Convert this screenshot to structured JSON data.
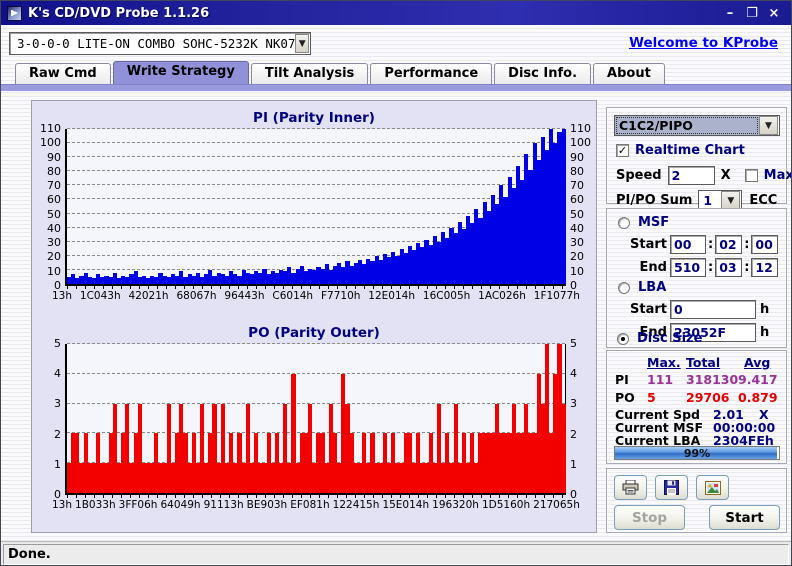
{
  "window": {
    "title": "K's CD/DVD Probe 1.1.26",
    "minimize": "–",
    "maximize": "❐",
    "close": "×",
    "status": "Done."
  },
  "toolbar": {
    "drive": "3-0-0-0 LITE-ON COMBO SOHC-5232K NK07",
    "welcome_link": "Welcome to KProbe"
  },
  "tabs": [
    {
      "label": "Raw Cmd"
    },
    {
      "label": "Write Strategy",
      "active": true
    },
    {
      "label": "Tilt Analysis"
    },
    {
      "label": "Performance"
    },
    {
      "label": "Disc Info."
    },
    {
      "label": "About"
    }
  ],
  "controls": {
    "mode_select": "C1C2/PIPO",
    "realtime_label": "Realtime Chart",
    "speed_label": "Speed",
    "speed_value": "2",
    "speed_unit": "X",
    "max_label": "Max",
    "pipo_sum_label": "PI/PO Sum",
    "pipo_sum_value": "1",
    "ecc_label": "ECC",
    "sep": ":",
    "msf": {
      "label": "MSF",
      "start_label": "Start",
      "end_label": "End",
      "start": [
        "00",
        "02",
        "00"
      ],
      "end": [
        "510",
        "03",
        "12"
      ]
    },
    "lba": {
      "label": "LBA",
      "start_label": "Start",
      "end_label": "End",
      "start": "0",
      "end": "23052F",
      "unit": "h"
    },
    "disc_size_label": "Disc Size"
  },
  "stats": {
    "headers": [
      "Max.",
      "Total",
      "Avg"
    ],
    "rows": [
      {
        "label": "PI",
        "max": "111",
        "total": "318130",
        "avg": "9.417",
        "color": "#993399"
      },
      {
        "label": "PO",
        "max": "5",
        "total": "29706",
        "avg": "0.879",
        "color": "#e80000"
      }
    ],
    "current": [
      {
        "label": "Current Spd",
        "value": "2.01",
        "unit": "X"
      },
      {
        "label": "Current MSF",
        "value": "00:00:00",
        "unit": ""
      },
      {
        "label": "Current LBA",
        "value": "2304FEh",
        "unit": ""
      }
    ],
    "progress": {
      "percent": 99,
      "label": "99%"
    }
  },
  "actions": {
    "print_icon": "printer-icon",
    "save_icon": "save-icon",
    "export_icon": "export-image-icon",
    "stop": "Stop",
    "start": "Start"
  },
  "chart_data": [
    {
      "type": "bar",
      "title": "PI (Parity Inner)",
      "bar_color": "#0000e6",
      "ylim": [
        0,
        110
      ],
      "ytick_step": 10,
      "grid": true,
      "x_labels": [
        "13h",
        "1C043h",
        "42021h",
        "68067h",
        "96443h",
        "C6014h",
        "F7710h",
        "12E014h",
        "16C005h",
        "1AC026h",
        "1F1077h"
      ],
      "values": [
        5,
        7,
        4,
        6,
        8,
        5,
        4,
        7,
        5,
        6,
        5,
        8,
        4,
        6,
        5,
        7,
        9,
        5,
        6,
        4,
        6,
        5,
        8,
        6,
        5,
        7,
        6,
        9,
        5,
        7,
        6,
        8,
        5,
        7,
        10,
        6,
        8,
        7,
        6,
        9,
        7,
        6,
        10,
        8,
        7,
        9,
        8,
        11,
        7,
        9,
        8,
        10,
        9,
        12,
        8,
        11,
        13,
        9,
        11,
        10,
        12,
        11,
        14,
        10,
        13,
        15,
        12,
        16,
        13,
        15,
        17,
        14,
        18,
        16,
        20,
        17,
        21,
        19,
        23,
        20,
        25,
        22,
        27,
        24,
        29,
        26,
        31,
        28,
        34,
        30,
        37,
        33,
        40,
        36,
        44,
        39,
        48,
        43,
        53,
        47,
        58,
        52,
        63,
        57,
        70,
        62,
        76,
        68,
        84,
        74,
        92,
        81,
        100,
        88,
        104,
        95,
        110,
        100,
        108,
        110
      ]
    },
    {
      "type": "bar",
      "title": "PO (Parity Outer)",
      "bar_color": "#f20000",
      "ylim": [
        0,
        5
      ],
      "ytick_step": 1,
      "grid": true,
      "x_labels": [
        "13h",
        "1B033h",
        "3FF06h",
        "64049h",
        "91113h",
        "BE903h",
        "EF081h",
        "122415h",
        "15E014h",
        "196320h",
        "1D5160h",
        "217065h"
      ],
      "values": [
        1,
        2,
        2,
        1,
        2,
        1,
        1,
        2,
        1,
        1,
        2,
        3,
        1,
        2,
        3,
        1,
        2,
        3,
        1,
        1,
        1,
        2,
        1,
        1,
        3,
        1,
        2,
        3,
        2,
        1,
        2,
        1,
        3,
        1,
        2,
        3,
        1,
        3,
        1,
        2,
        1,
        2,
        1,
        3,
        1,
        2,
        1,
        1,
        2,
        1,
        2,
        1,
        3,
        1,
        4,
        1,
        2,
        2,
        3,
        1,
        2,
        2,
        1,
        3,
        2,
        1,
        4,
        3,
        2,
        1,
        1,
        2,
        1,
        2,
        1,
        1,
        2,
        1,
        2,
        1,
        1,
        2,
        2,
        1,
        2,
        1,
        1,
        2,
        1,
        3,
        1,
        2,
        1,
        3,
        1,
        2,
        1,
        2,
        1,
        2,
        2,
        2,
        2,
        3,
        2,
        2,
        2,
        3,
        2,
        2,
        3,
        2,
        2,
        4,
        3,
        5,
        2,
        4,
        5,
        3
      ]
    }
  ]
}
